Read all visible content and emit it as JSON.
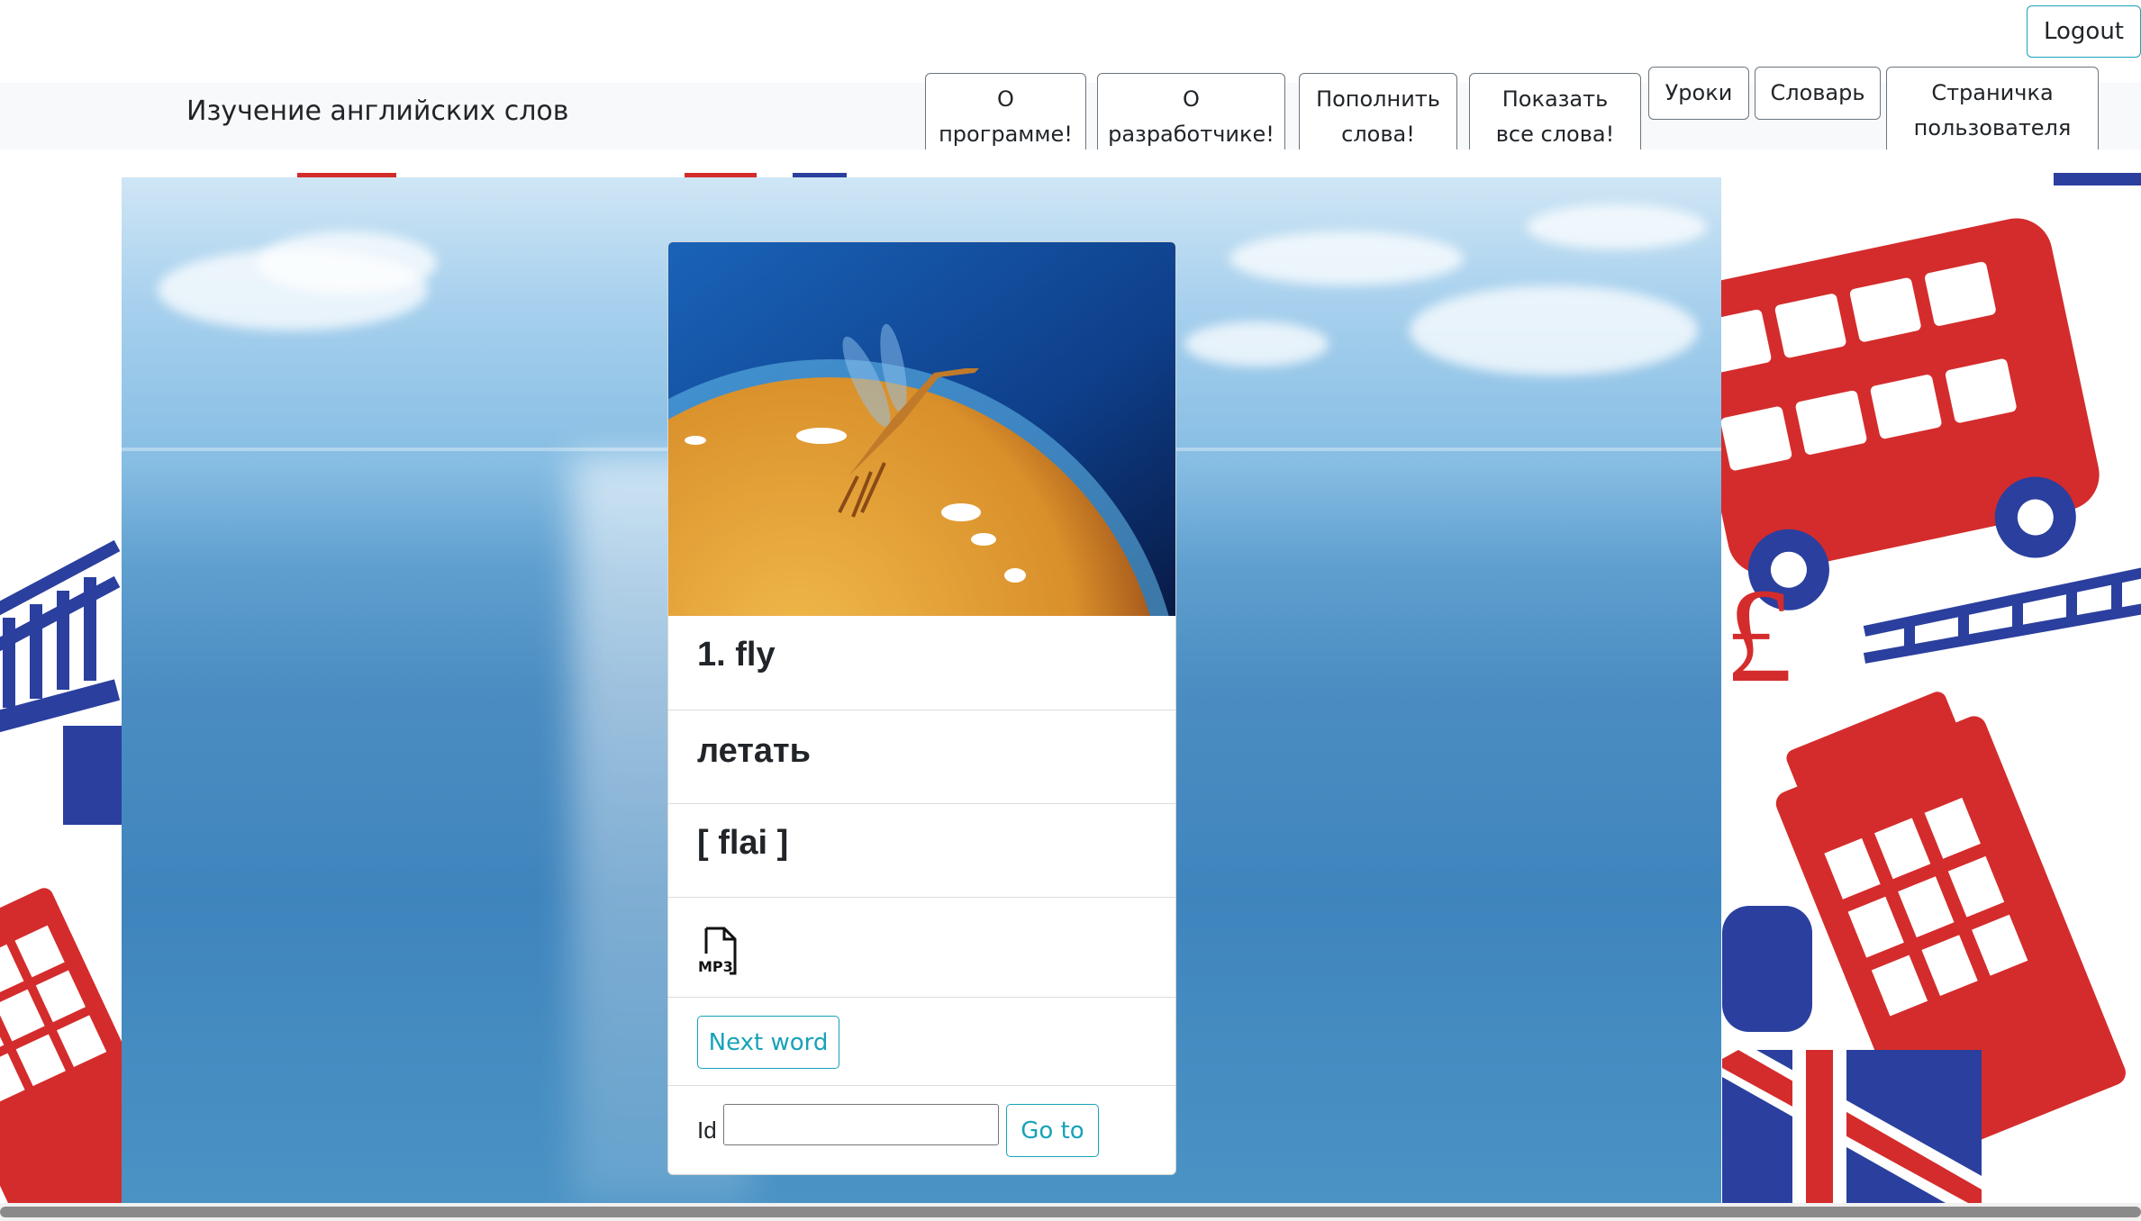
{
  "header": {
    "logout_label": "Logout"
  },
  "navbar": {
    "brand": "Изучение английских слов",
    "buttons": [
      {
        "line1": "О",
        "line2": "программе!"
      },
      {
        "line1": "О",
        "line2": "разработчике!"
      },
      {
        "line1": "Пополнить",
        "line2": "слова!"
      },
      {
        "line1": "Показать",
        "line2": "все слова!"
      },
      {
        "line1": "Уроки"
      },
      {
        "line1": "Словарь"
      },
      {
        "line1": "Страничка",
        "line2": "пользователя"
      }
    ]
  },
  "card": {
    "word": "1. fly",
    "translation": "летать",
    "transcription": "[ flai ]",
    "audio_icon": "mp3-file-icon",
    "audio_label": "MP3",
    "next_button": "Next word",
    "id_label": "Id",
    "id_value": "",
    "goto_button": "Go to"
  },
  "colors": {
    "accent": "#17a2b8",
    "pattern_red": "#d42c2c",
    "pattern_blue": "#2b3f9e"
  }
}
